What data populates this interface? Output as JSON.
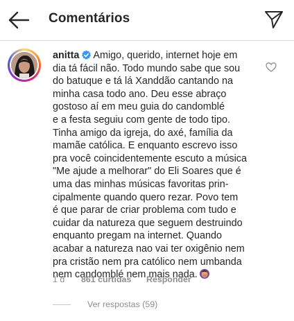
{
  "header": {
    "title": "Comentários",
    "back_icon": "arrow-left-icon",
    "share_icon": "paper-plane-icon"
  },
  "comment": {
    "username": "anitta",
    "verified": true,
    "verified_color": "#3897f0",
    "text_lines": [
      "Amigo, querido, internet hoje em",
      "dia tá fácil não. Todo mundo sabe que sou",
      "do batuque e tá lá Xanddão cantando na",
      "minha casa todo ano. Deu esse abraço",
      "gostoso aí em meu guia do candomblé",
      "e a festa seguiu com gente de todo tipo.",
      "Tinha amigo da igreja, do axé, família da",
      "mamãe católica. E enquanto escrevo isso",
      "pra você coincidentemente escuto a música",
      "\"Me ajude a melhorar\" do Eli Soares que é",
      "uma das minhas músicas favoritas prin-",
      "cipalmente quando quero rezar. Povo tem",
      "é que parar de criar problema com tudo e",
      "cuidar da natureza que seguem destruindo",
      "enquanto pregam na internet. Quando",
      "acabar a natureza nao vai ter oxigênio nem",
      "pra cristão nem pra católico nem umbanda",
      "nem candomblé nem mais nada."
    ],
    "end_emoji": "woman-facepalming-emoji",
    "like_icon": "heart-outline-icon",
    "age": "1 d",
    "likes": "861 curtidas",
    "reply_label": "Responder",
    "view_replies": "Ver respostas (59)"
  }
}
